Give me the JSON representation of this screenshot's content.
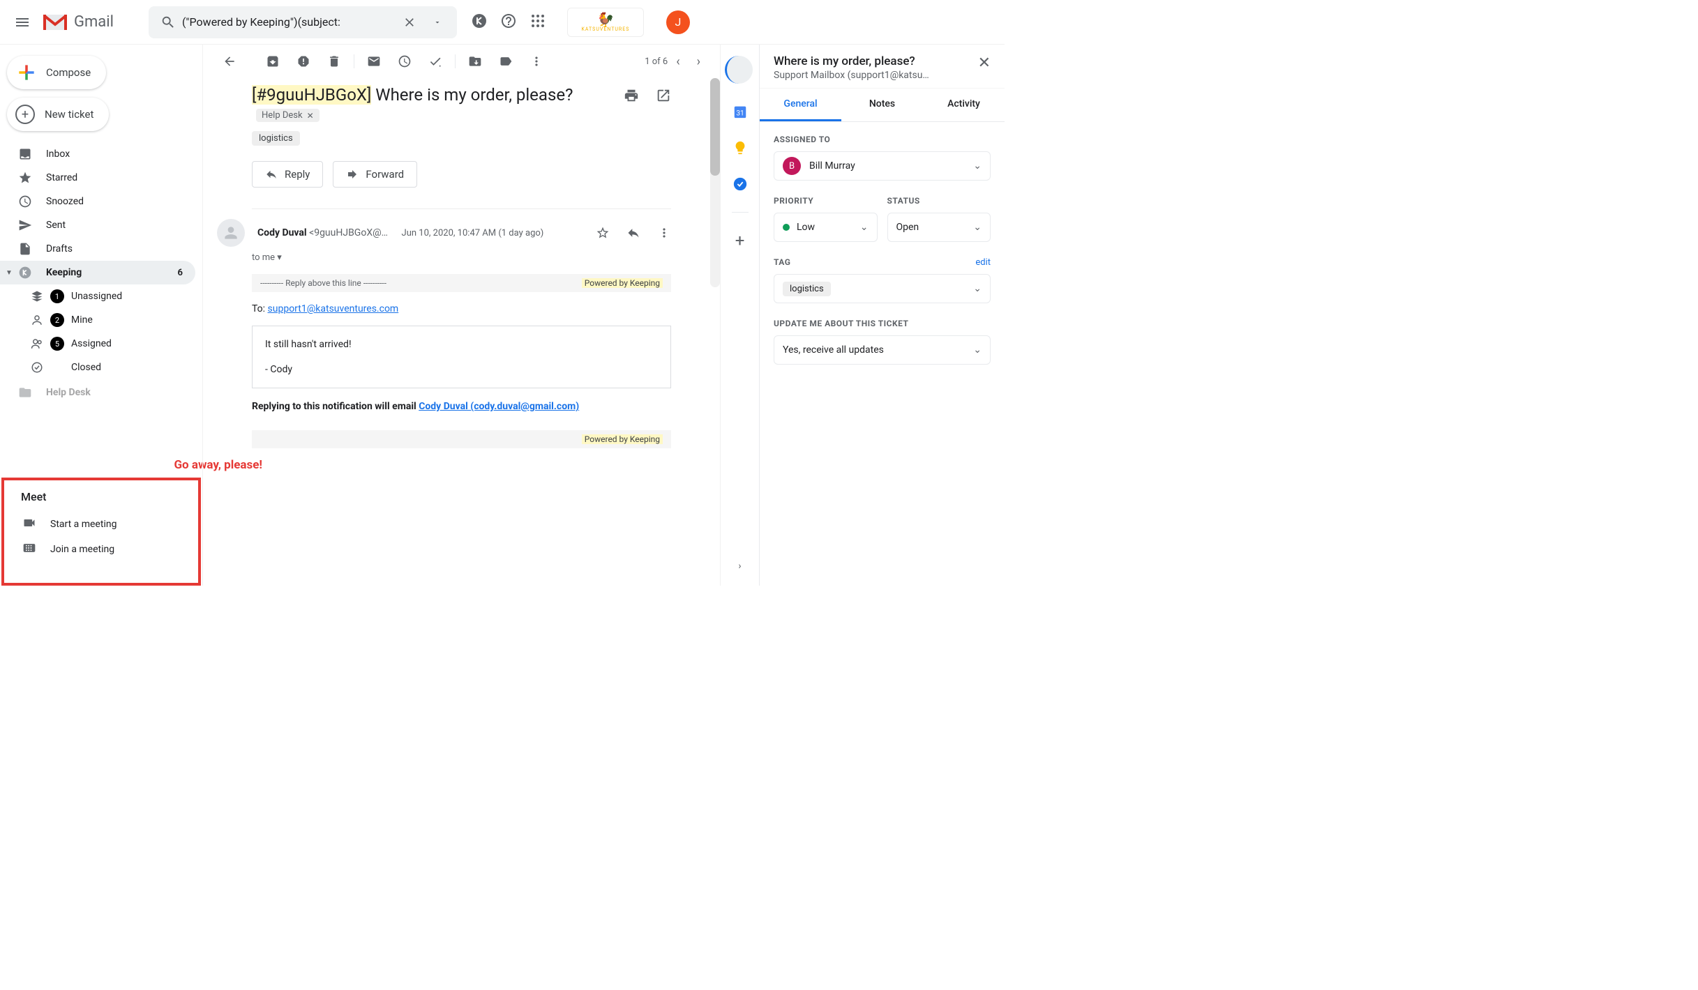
{
  "header": {
    "product": "Gmail",
    "search_value": "(\"Powered by Keeping\")(subject:",
    "avatar_initial": "J",
    "katsu": "KATSUVENTURES"
  },
  "compose": {
    "label": "Compose",
    "new_ticket": "New ticket"
  },
  "nav": {
    "inbox": "Inbox",
    "starred": "Starred",
    "snoozed": "Snoozed",
    "sent": "Sent",
    "drafts": "Drafts",
    "keeping": "Keeping",
    "keeping_count": "6",
    "unassigned": "Unassigned",
    "unassigned_badge": "1",
    "mine": "Mine",
    "mine_badge": "2",
    "assigned": "Assigned",
    "assigned_badge": "5",
    "closed": "Closed",
    "helpdesk": "Help Desk"
  },
  "annotation": "Go away, please!",
  "meet": {
    "title": "Meet",
    "start": "Start a meeting",
    "join": "Join a meeting"
  },
  "toolbar": {
    "pager": "1 of 6"
  },
  "email": {
    "ticket_id": "[#9guuHJBGoX]",
    "subject_rest": " Where is my order, please?",
    "label_helpdesk": "Help Desk",
    "label_logistics": "logistics",
    "reply": "Reply",
    "forward": "Forward",
    "from_name": "Cody Duval",
    "from_addr": " <9guuHJBGoX@…",
    "date": "Jun 10, 2020, 10:47 AM (1 day ago)",
    "to_line": "to me",
    "banner_left": "---------- Reply above this line ----------",
    "banner_right": "Powered by Keeping",
    "to_label": "To: ",
    "to_email": "support1@katsuventures.com",
    "body_line1": "It still hasn't arrived!",
    "body_line2": "- Cody",
    "reply_note_pre": "Replying to this notification will email ",
    "reply_note_link": "Cody Duval (cody.duval@gmail.com)"
  },
  "panel": {
    "title": "Where is my order, please?",
    "subtitle": "Support Mailbox (support1@katsu…",
    "tab_general": "General",
    "tab_notes": "Notes",
    "tab_activity": "Activity",
    "assigned_label": "ASSIGNED TO",
    "assignee_initial": "B",
    "assignee": "Bill Murray",
    "priority_label": "PRIORITY",
    "priority": "Low",
    "status_label": "STATUS",
    "status": "Open",
    "tag_label": "TAG",
    "edit": "edit",
    "tag_value": "logistics",
    "update_label": "UPDATE ME ABOUT THIS TICKET",
    "update_value": "Yes, receive all updates"
  }
}
